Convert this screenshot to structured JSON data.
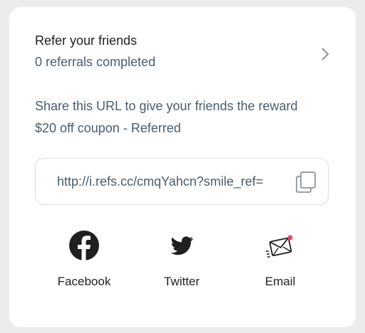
{
  "referral": {
    "title": "Refer your friends",
    "subtitle": "0 referrals completed",
    "description": "Share this URL to give your friends the reward $20 off coupon - Referred",
    "url": "http://i.refs.cc/cmqYahcn?smile_ref=",
    "copy_icon": "copy-icon",
    "chevron_icon": "chevron-right-icon"
  },
  "share": {
    "items": [
      {
        "label": "Facebook",
        "icon": "facebook-icon"
      },
      {
        "label": "Twitter",
        "icon": "twitter-icon"
      },
      {
        "label": "Email",
        "icon": "email-icon"
      }
    ]
  },
  "colors": {
    "background": "#ececec",
    "card": "#ffffff",
    "text_primary": "#1f1f1f",
    "text_secondary": "#4a5d6d",
    "accent_pink": "#e8476b"
  }
}
